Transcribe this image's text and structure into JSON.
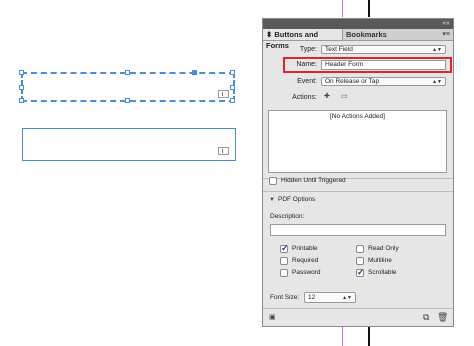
{
  "panel": {
    "tab_active": "Buttons and Forms",
    "tab_inactive": "Bookmarks",
    "close_glyph": "««",
    "menu_glyph": "▾≡",
    "type_label": "Type:",
    "type_value": "Text Field",
    "name_label": "Name:",
    "name_value": "Header Form",
    "event_label": "Event:",
    "event_value": "On Release or Tap",
    "actions_label": "Actions:",
    "actions_empty": "[No Actions Added]",
    "hidden_label": "Hidden Until Triggered",
    "pdf_options_label": "PDF Options",
    "description_label": "Description:",
    "description_value": "",
    "options": [
      {
        "label": "Printable",
        "checked": true
      },
      {
        "label": "Required",
        "checked": false
      },
      {
        "label": "Password",
        "checked": false
      },
      {
        "label": "Read Only",
        "checked": false
      },
      {
        "label": "Multiline",
        "checked": false
      },
      {
        "label": "Scrollable",
        "checked": true
      }
    ],
    "font_size_label": "Font Size:",
    "font_size_value": "12",
    "highlight_color": "#e0262a"
  },
  "icons": {
    "add_action": "add-action-icon",
    "remove_action": "remove-action-icon",
    "preview": "preview-icon",
    "convert": "convert-icon",
    "trash": "trash-icon"
  }
}
